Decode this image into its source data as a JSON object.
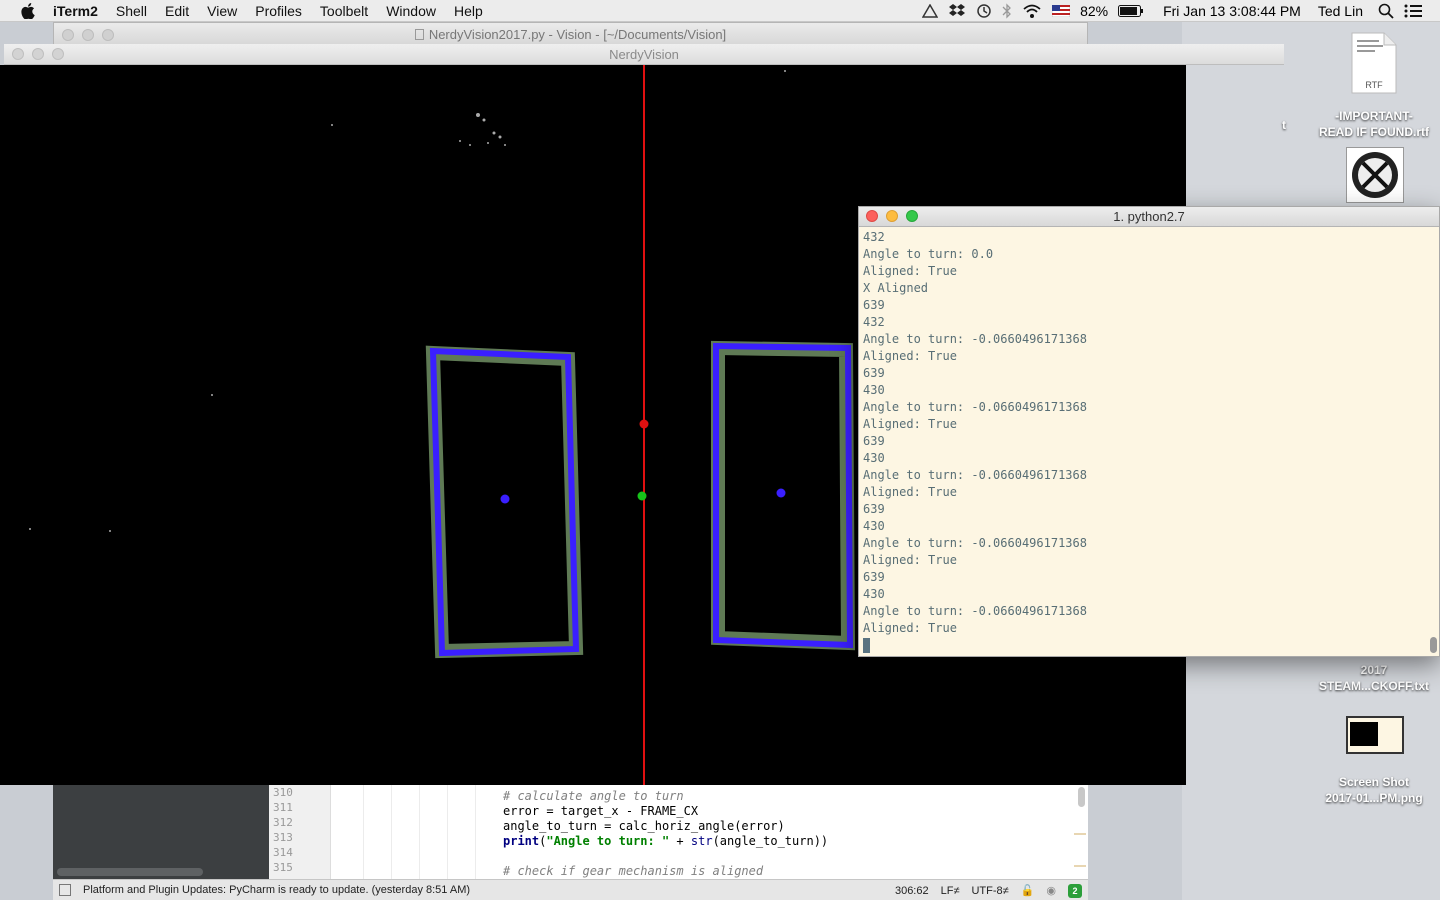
{
  "menubar": {
    "app": "iTerm2",
    "items": [
      "Shell",
      "Edit",
      "View",
      "Profiles",
      "Toolbelt",
      "Window",
      "Help"
    ],
    "battery": "82%",
    "clock": "Fri Jan 13  3:08:44 PM",
    "user": "Ted Lin"
  },
  "pycharm": {
    "title": "NerdyVision2017.py - Vision - [~/Documents/Vision]",
    "line_numbers": [
      "310",
      "311",
      "312",
      "313",
      "314",
      "315"
    ],
    "status_message": "Platform and Plugin Updates: PyCharm is ready to update. (yesterday 8:51 AM)",
    "cursor_pos": "306:62",
    "line_sep": "LF≠",
    "encoding": "UTF-8≠",
    "notification_count": "2"
  },
  "code": {
    "l310": "# calculate angle to turn",
    "l311": "error = target_x - FRAME_CX",
    "l312": "angle_to_turn = calc_horiz_angle(error)",
    "l313_kw": "print",
    "l313_str": "\"Angle to turn: \"",
    "l313_op": " + ",
    "l313_fn": "str",
    "l313_rest": "(angle_to_turn))",
    "l315": "# check if gear mechanism is aligned"
  },
  "nerdy": {
    "title": "NerdyVision"
  },
  "iterm": {
    "title": "1. python2.7",
    "lines": [
      "432",
      "Angle to turn: 0.0",
      "Aligned: True",
      "X Aligned",
      "639",
      "432",
      "Angle to turn: -0.0660496171368",
      "Aligned: True",
      "639",
      "430",
      "Angle to turn: -0.0660496171368",
      "Aligned: True",
      "639",
      "430",
      "Angle to turn: -0.0660496171368",
      "Aligned: True",
      "639",
      "430",
      "Angle to turn: -0.0660496171368",
      "Aligned: True",
      "639",
      "430",
      "Angle to turn: -0.0660496171368",
      "Aligned: True"
    ]
  },
  "desktop": {
    "items": [
      {
        "label": "-IMPORTANT-\nREAD IF FOUND.rtf",
        "icon": "rtf-document-icon",
        "icon_text": "RTF"
      },
      {
        "label": "2017\nSTEAM...CKOFF.txt",
        "icon": "text-document-icon"
      },
      {
        "label": "Screen Shot\n2017-01...PM.png",
        "icon": "screenshot-icon"
      }
    ],
    "partial_label": "t"
  },
  "colors": {
    "target_outline": "#3a1fff",
    "target_fill": "#5f7a55",
    "centerline": "#e01010",
    "center_dot": "#17c21a",
    "term_bg": "#fdf6e3",
    "term_fg": "#586e75"
  }
}
